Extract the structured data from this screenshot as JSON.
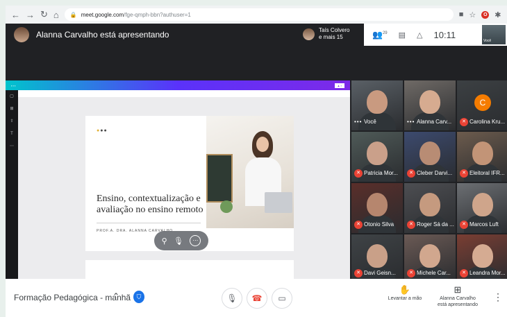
{
  "browser": {
    "url_host": "meet.google.com",
    "url_path": "/fge-qmph-bbn?authuser=1"
  },
  "header": {
    "presenter_text": "Alanna Carvalho está apresentando",
    "people_chip": {
      "line1": "Taís Colvero",
      "line2": "e mais 15"
    },
    "participant_count": "29",
    "clock": "10:11",
    "self_label": "Você"
  },
  "slide": {
    "headline": "Ensino, contextualização e avaliação no ensino remoto",
    "author": "PROF.A. DRA. ALANNA CARVALHO"
  },
  "participants": [
    {
      "name": "Você",
      "muted": false,
      "bg": "#5a6066",
      "skin": "#c99a80"
    },
    {
      "name": "Alanna Carv...",
      "muted": false,
      "bg": "#6f6a66",
      "skin": "#d6ab90",
      "active": true
    },
    {
      "name": "Carolina Kru...",
      "muted": true,
      "bg": "#3c4043",
      "initial": "C"
    },
    {
      "name": "Patricia Mor...",
      "muted": true,
      "bg": "#4f5a58",
      "skin": "#caa08a"
    },
    {
      "name": "Cleber Darvi...",
      "muted": true,
      "bg": "#3c4a6e",
      "skin": "#b88c74"
    },
    {
      "name": "Eleitoral IFR...",
      "muted": true,
      "bg": "#6c5b4d",
      "skin": "#c29477"
    },
    {
      "name": "Otonio Silva",
      "muted": true,
      "bg": "#5a2e2a",
      "skin": "#b6866e"
    },
    {
      "name": "Roger Sá da ...",
      "muted": true,
      "bg": "#4d4e52",
      "skin": "#c59a7f"
    },
    {
      "name": "Marcos Luft",
      "muted": true,
      "bg": "#6c6f73",
      "skin": "#cfa58b"
    },
    {
      "name": "Davi Geisn...",
      "muted": true,
      "bg": "#3f4346",
      "skin": "#c9a088"
    },
    {
      "name": "Michele Car...",
      "muted": true,
      "bg": "#6b5a55",
      "skin": "#d1a78e"
    },
    {
      "name": "Leandra Mor...",
      "muted": true,
      "bg": "#7a3e33",
      "skin": "#d5ab92"
    }
  ],
  "bottom": {
    "meeting_title": "Formação Pedagógica - manhã",
    "raise_hand_label": "Levantar a mão",
    "presenting_label_1": "Alanna Carvalho",
    "presenting_label_2": "está apresentando"
  },
  "colors": {
    "meet_bg": "#202124",
    "accent_blue": "#1a73e8",
    "hangup_red": "#ea4335",
    "muted_red": "#ea4335"
  }
}
